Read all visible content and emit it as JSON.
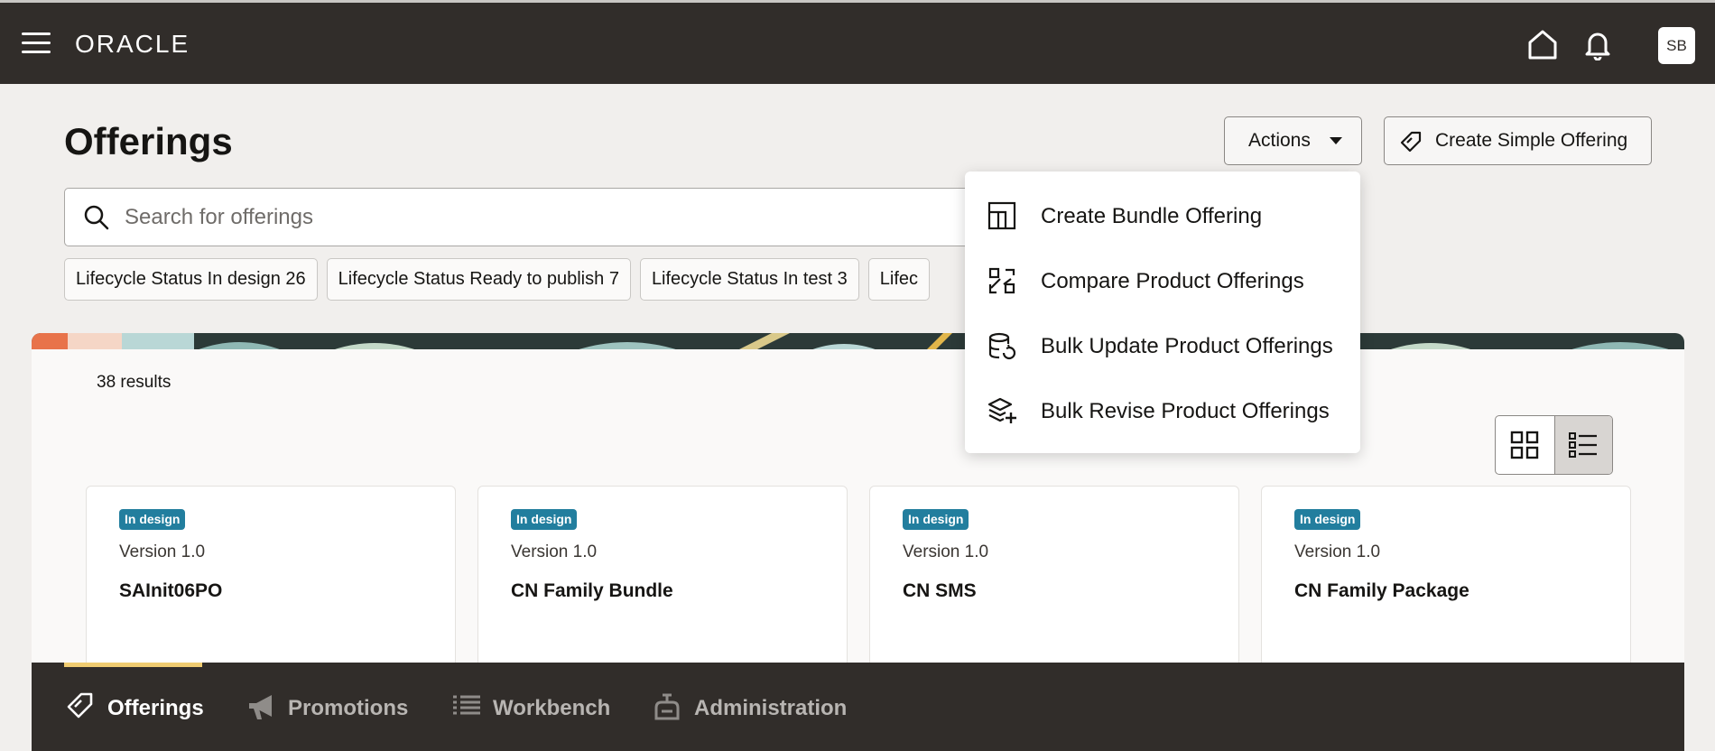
{
  "header": {
    "logo": "ORACLE",
    "avatar_initials": "SB"
  },
  "page": {
    "title": "Offerings",
    "actions_label": "Actions",
    "create_label": "Create Simple Offering"
  },
  "search": {
    "placeholder": "Search for offerings",
    "value": ""
  },
  "filters": [
    {
      "name": "Lifecycle Status",
      "value": "In design",
      "count": "26"
    },
    {
      "name": "Lifecycle Status",
      "value": "Ready to publish",
      "count": "7"
    },
    {
      "name": "Lifecycle Status",
      "value": "In test",
      "count": "3"
    },
    {
      "name": "Lifec",
      "value": "",
      "count": ""
    }
  ],
  "results": {
    "count_text": "38 results"
  },
  "view_toggle": {
    "selected": "list"
  },
  "cards": [
    {
      "status": "In design",
      "version": "Version 1.0",
      "name": "SAInit06PO"
    },
    {
      "status": "In design",
      "version": "Version 1.0",
      "name": "CN Family Bundle"
    },
    {
      "status": "In design",
      "version": "Version 1.0",
      "name": "CN SMS"
    },
    {
      "status": "In design",
      "version": "Version 1.0",
      "name": "CN Family Package"
    }
  ],
  "actions_menu": [
    {
      "icon": "bundle-icon",
      "label": "Create Bundle Offering"
    },
    {
      "icon": "compare-icon",
      "label": "Compare Product Offerings"
    },
    {
      "icon": "bulk-update-icon",
      "label": "Bulk Update Product Offerings"
    },
    {
      "icon": "bulk-revise-icon",
      "label": "Bulk Revise Product Offerings"
    }
  ],
  "bottom_nav": [
    {
      "icon": "offerings-tag-icon",
      "label": "Offerings",
      "active": true
    },
    {
      "icon": "megaphone-icon",
      "label": "Promotions",
      "active": false
    },
    {
      "icon": "list-icon",
      "label": "Workbench",
      "active": false
    },
    {
      "icon": "admin-icon",
      "label": "Administration",
      "active": false
    }
  ],
  "colors": {
    "header_bg": "#312d2a",
    "badge_bg": "#227e9e",
    "active_tab_indicator": "#f0cc71",
    "page_bg": "#f1efed"
  }
}
